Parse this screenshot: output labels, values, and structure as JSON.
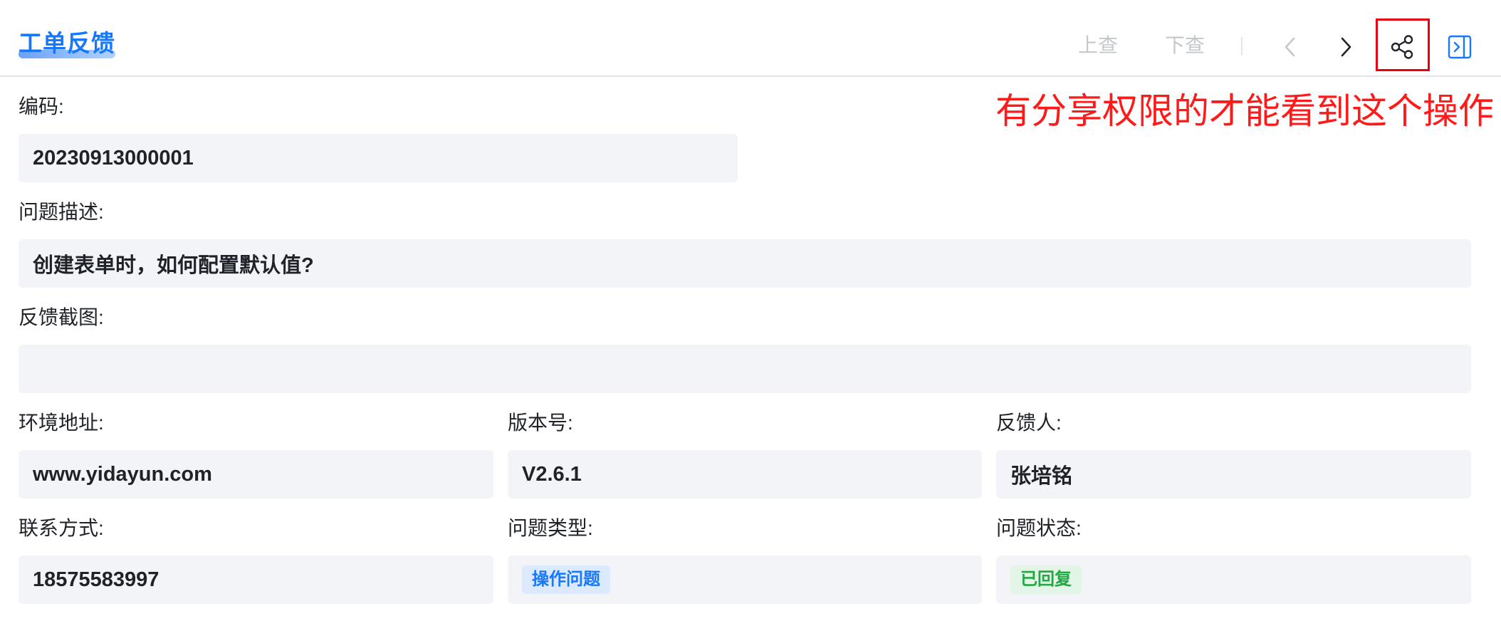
{
  "header": {
    "title": "工单反馈",
    "prev_record_label": "上查",
    "next_record_label": "下查",
    "icons": [
      "chevron-left-icon",
      "chevron-right-icon",
      "share-icon",
      "collapse-panel-icon"
    ]
  },
  "annotation": {
    "text": "有分享权限的才能看到这个操作",
    "color": "#ff1a1a",
    "highlight_color": "#e60012"
  },
  "form": {
    "code": {
      "label": "编码:",
      "value": "20230913000001"
    },
    "description": {
      "label": "问题描述:",
      "value": "创建表单时，如何配置默认值?"
    },
    "screenshot": {
      "label": "反馈截图:",
      "value": ""
    },
    "env_address": {
      "label": "环境地址:",
      "value": "www.yidayun.com"
    },
    "version": {
      "label": "版本号:",
      "value": "V2.6.1"
    },
    "reporter": {
      "label": "反馈人:",
      "value": "张培铭"
    },
    "contact": {
      "label": "联系方式:",
      "value": "18575583997"
    },
    "issue_type": {
      "label": "问题类型:",
      "value": "操作问题",
      "tag_color": "#1677ff"
    },
    "issue_status": {
      "label": "问题状态:",
      "value": "已回复",
      "tag_color": "#22a745"
    }
  },
  "colors": {
    "accent": "#1677ff",
    "field_background": "#f3f4f7",
    "disabled_text": "#c4c7cc"
  }
}
